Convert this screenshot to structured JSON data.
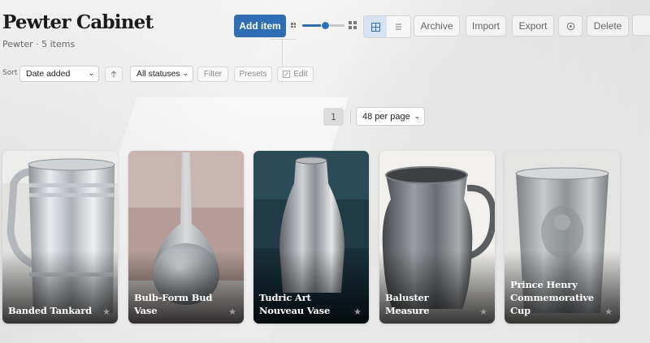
{
  "header": {
    "title": "Pewter Cabinet",
    "subtitle": "Pewter · 5 items"
  },
  "toolbar": {
    "add_label": "Add item",
    "thumb_size": 0.55,
    "archive_label": "Archive",
    "import_label": "Import",
    "export_label": "Export",
    "delete_label": "Delete"
  },
  "filters": {
    "sort_label": "Sort",
    "sort_value": "Date added",
    "status_value": "All statuses",
    "filter_label": "Filter",
    "presets_label": "Presets",
    "edit_label": "Edit"
  },
  "pagination": {
    "current_page": "1",
    "per_page": "48 per page"
  },
  "items": [
    {
      "name": "Banded Tankard"
    },
    {
      "name": "Bulb-Form Bud Vase"
    },
    {
      "name": "Tudric Art Nouveau Vase"
    },
    {
      "name": "Baluster Measure"
    },
    {
      "name": "Prince Henry Commemorative Cup"
    }
  ],
  "colors": {
    "accent": "#2f6db5",
    "star": "#9a9a9a"
  }
}
